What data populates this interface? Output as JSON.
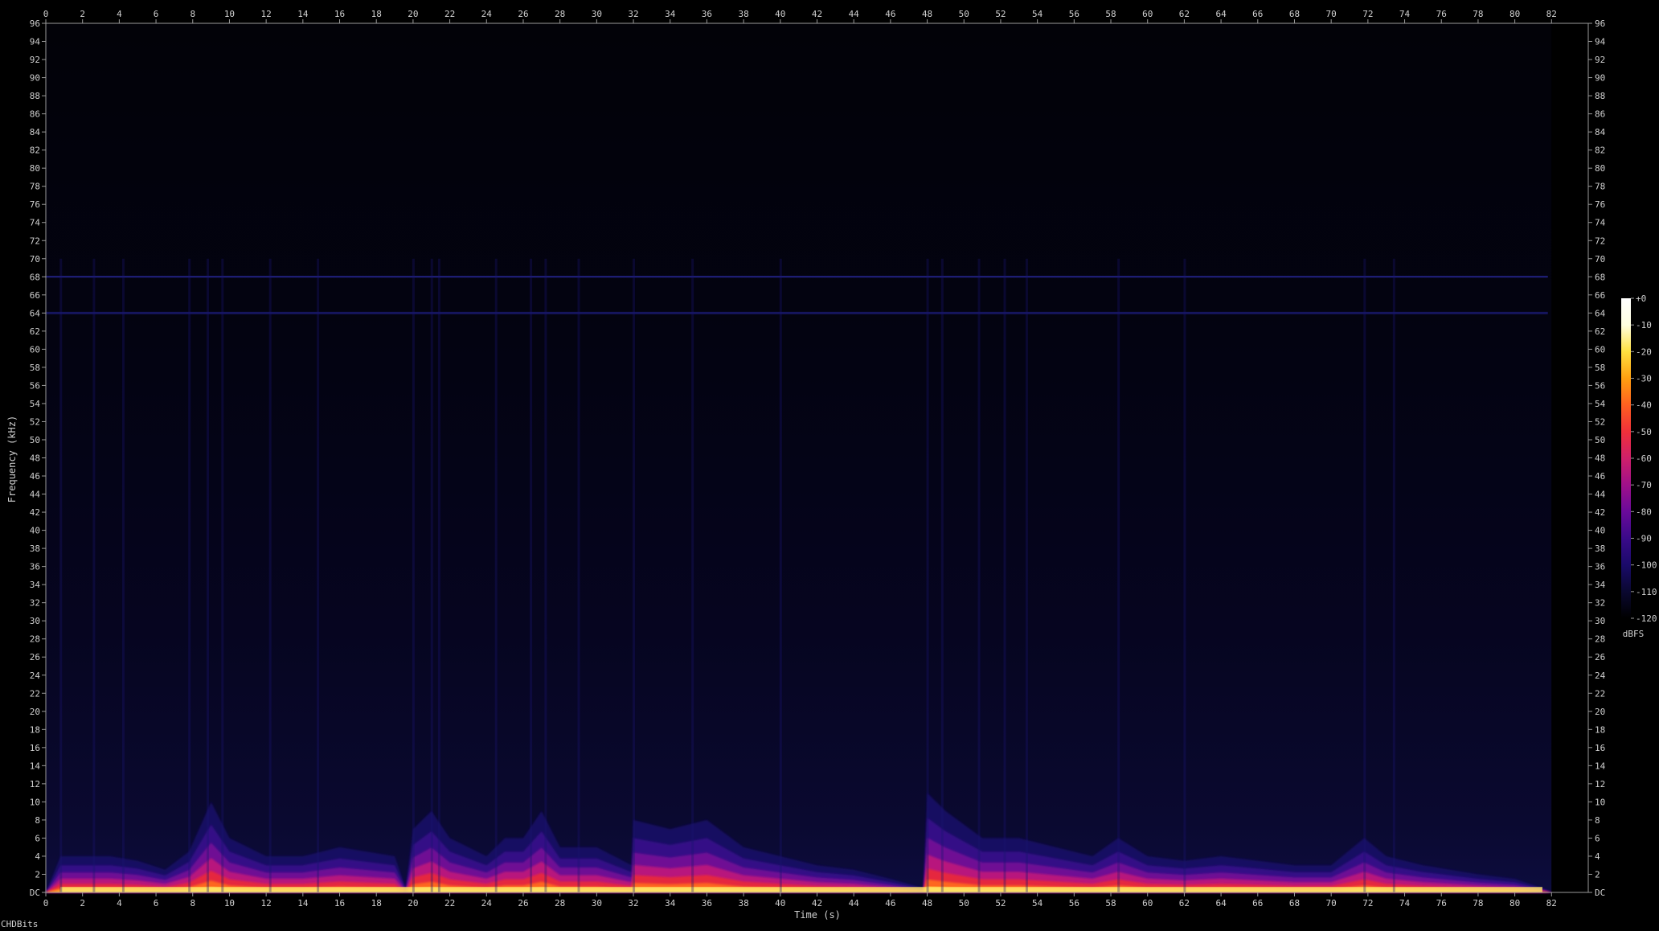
{
  "footer_label": "CHDBits",
  "chart_data": {
    "type": "heatmap",
    "subtype": "spectrogram",
    "title": "",
    "xlabel": "Time (s)",
    "ylabel": "Frequency (kHz)",
    "xlim": [
      0,
      84
    ],
    "ylim": [
      0,
      96
    ],
    "data_end_time": 82,
    "x_ticks": [
      "0",
      "2",
      "4",
      "6",
      "8",
      "10",
      "12",
      "14",
      "16",
      "18",
      "20",
      "22",
      "24",
      "26",
      "28",
      "30",
      "32",
      "34",
      "36",
      "38",
      "40",
      "42",
      "44",
      "46",
      "48",
      "50",
      "52",
      "54",
      "56",
      "58",
      "60",
      "62",
      "64",
      "66",
      "68",
      "70",
      "72",
      "74",
      "76",
      "78",
      "80",
      "82"
    ],
    "y_ticks": [
      "DC",
      "2",
      "4",
      "6",
      "8",
      "10",
      "12",
      "14",
      "16",
      "18",
      "20",
      "22",
      "24",
      "26",
      "28",
      "30",
      "32",
      "34",
      "36",
      "38",
      "40",
      "42",
      "44",
      "46",
      "48",
      "50",
      "52",
      "54",
      "56",
      "58",
      "60",
      "62",
      "64",
      "66",
      "68",
      "70",
      "72",
      "74",
      "76",
      "78",
      "80",
      "82",
      "84",
      "86",
      "88",
      "90",
      "92",
      "94",
      "96"
    ],
    "colorbar": {
      "label": "dBFS",
      "ticks": [
        "+0",
        "-10",
        "-20",
        "-30",
        "-40",
        "-50",
        "-60",
        "-70",
        "-80",
        "-90",
        "-100",
        "-110",
        "-120"
      ],
      "range": [
        -120,
        0
      ],
      "colors": [
        "#000000",
        "#0a0830",
        "#1a0a6a",
        "#3a0a8a",
        "#6a0a9a",
        "#a0108a",
        "#d0206a",
        "#f0303a",
        "#ff6020",
        "#ffa010",
        "#ffe040",
        "#ffffe0",
        "#ffffff"
      ]
    },
    "tonal_lines_khz": [
      68,
      64
    ],
    "onsets_s": [
      0.8,
      2.6,
      4.2,
      7.8,
      8.8,
      9.6,
      12.2,
      14.8,
      20,
      21,
      21.4,
      24.5,
      26.4,
      27.2,
      29,
      32,
      35.2,
      40,
      48,
      48.8,
      50.8,
      52.2,
      53.4,
      58.4,
      62,
      71.8,
      73.4
    ],
    "energy_envelope": {
      "time_s": [
        0,
        0.8,
        2,
        3.5,
        5,
        6.5,
        7.8,
        9,
        10,
        12,
        14,
        16,
        19,
        19.6,
        20,
        21,
        22,
        24,
        24.5,
        25,
        26,
        27,
        28,
        30,
        31.9,
        32,
        34,
        36,
        38,
        40,
        42,
        44,
        46,
        47.8,
        48,
        49,
        51,
        53,
        55,
        57,
        58.4,
        60,
        62,
        64,
        66,
        68,
        70,
        71.8,
        73,
        75,
        78,
        80,
        81.5,
        82
      ],
      "top_khz": [
        0,
        4,
        4,
        4,
        3.5,
        2.5,
        4.5,
        10,
        6,
        4,
        4,
        5,
        4,
        0.5,
        7,
        9,
        6,
        4,
        5,
        6,
        6,
        9,
        5,
        5,
        3,
        8,
        7,
        8,
        5,
        4,
        3,
        2.5,
        1.5,
        0.5,
        11,
        9,
        6,
        6,
        5,
        4,
        6,
        4,
        3.5,
        4,
        3.5,
        3,
        3,
        6,
        4,
        3,
        2,
        1.5,
        0.5,
        0
      ]
    }
  }
}
